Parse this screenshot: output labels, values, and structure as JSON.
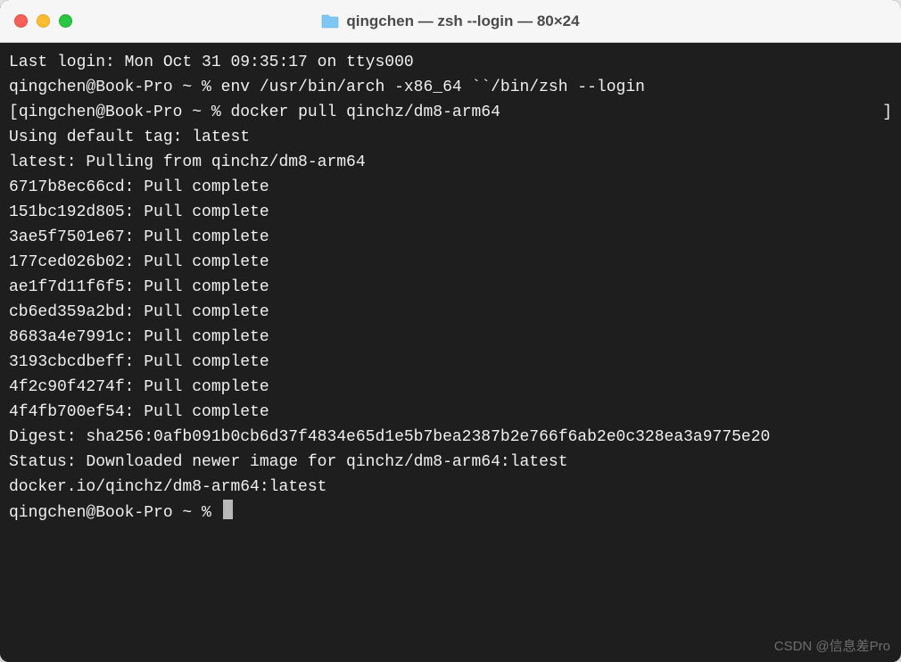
{
  "window": {
    "title": "qingchen — zsh --login — 80×24"
  },
  "terminal": {
    "lines": {
      "last_login": "Last login: Mon Oct 31 09:35:17 on ttys000",
      "prompt1": "qingchen@Book-Pro ~ % env /usr/bin/arch -x86_64 ``/bin/zsh --login",
      "prompt2": "qingchen@Book-Pro ~ % docker pull qinchz/dm8-arm64",
      "using_default": "Using default tag: latest",
      "pulling_from": "latest: Pulling from qinchz/dm8-arm64",
      "pull1": "6717b8ec66cd: Pull complete ",
      "pull2": "151bc192d805: Pull complete ",
      "pull3": "3ae5f7501e67: Pull complete ",
      "pull4": "177ced026b02: Pull complete ",
      "pull5": "ae1f7d11f6f5: Pull complete ",
      "pull6": "cb6ed359a2bd: Pull complete ",
      "pull7": "8683a4e7991c: Pull complete ",
      "pull8": "3193cbcdbeff: Pull complete ",
      "pull9": "4f2c90f4274f: Pull complete ",
      "pull10": "4f4fb700ef54: Pull complete ",
      "digest": "Digest: sha256:0afb091b0cb6d37f4834e65d1e5b7bea2387b2e766f6ab2e0c328ea3a9775e20",
      "status": "Status: Downloaded newer image for qinchz/dm8-arm64:latest",
      "image_ref": "docker.io/qinchz/dm8-arm64:latest",
      "prompt3": "qingchen@Book-Pro ~ % "
    }
  },
  "watermark": "CSDN @信息差Pro"
}
